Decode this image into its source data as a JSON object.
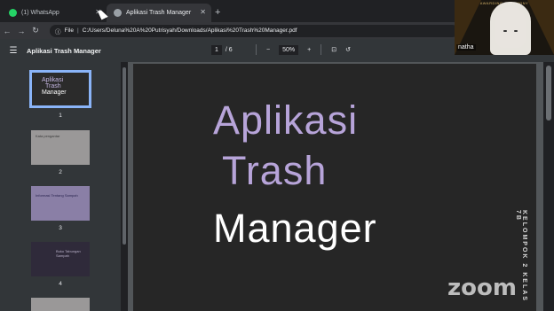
{
  "browser": {
    "tabs": [
      {
        "label": "(1) WhatsApp",
        "icon": "whatsapp-icon",
        "icon_color": "#25d366"
      },
      {
        "label": "Aplikasi Trash Manager",
        "icon": "pdf-globe-icon",
        "icon_color": "#9aa0a6"
      }
    ],
    "new_tab": "+",
    "url_scheme": "File",
    "url": "C:/Users/Deluna%20A%20Putrisyah/Downloads/Aplikasi%20Trash%20Manager.pdf"
  },
  "viewer": {
    "title": "Aplikasi Trash Manager",
    "page_current": "1",
    "page_total": "/ 6",
    "zoom": "50%",
    "zoom_out": "−",
    "zoom_in": "+"
  },
  "thumbnails": [
    {
      "num": "1",
      "line1": "Aplikasi",
      "line2": "Trash",
      "line3": "Manager"
    },
    {
      "num": "2",
      "text": "Kata pengantar"
    },
    {
      "num": "3",
      "text": "Informasi Tentang Sampah"
    },
    {
      "num": "4",
      "text": "Buku Tabungan Sampah"
    }
  ],
  "slide": {
    "line1": "Aplikasi",
    "line2": "Trash",
    "line3": "Manager",
    "vertical": "KELOMPOK 2 KELAS 7B",
    "accent": "#b7a4d9"
  },
  "video": {
    "participant": "natha",
    "banner": "AWARDING CEREMONY",
    "watermark": "zoom"
  }
}
